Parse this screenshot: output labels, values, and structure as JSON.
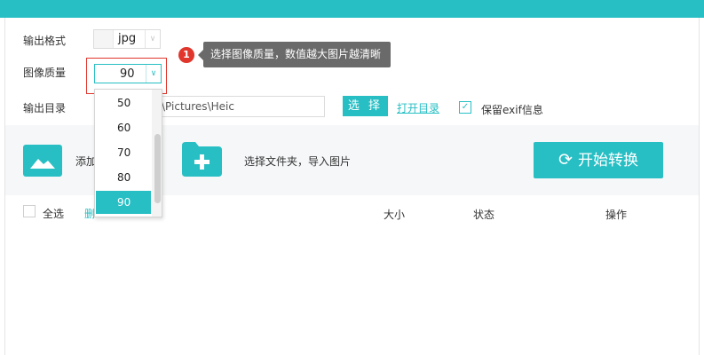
{
  "settings": {
    "format_label": "输出格式",
    "format_value": "jpg",
    "quality_label": "图像质量",
    "quality_value": "90",
    "output_dir_label": "输出目录",
    "output_dir_value": "\\Pictures\\Heic",
    "choose_button": "选 择",
    "open_dir_link": "打开目录",
    "keep_exif_label": "保留exif信息",
    "keep_exif_checked": true
  },
  "tooltip": {
    "badge": "1",
    "text": "选择图像质量，数值越大图片越清晰"
  },
  "dropdown": {
    "options": [
      "50",
      "60",
      "70",
      "80",
      "90"
    ],
    "selected": "90"
  },
  "toolbar": {
    "add_label": "添加",
    "folder_label": "选择文件夹，导入图片",
    "start_button": "开始转换"
  },
  "table": {
    "select_all": "全选",
    "delete_link": "删",
    "columns": [
      "大小",
      "状态",
      "操作"
    ]
  },
  "colors": {
    "accent": "#27bfc4",
    "highlight_border": "#e0362c",
    "tooltip_bg": "#6a6a6a"
  }
}
